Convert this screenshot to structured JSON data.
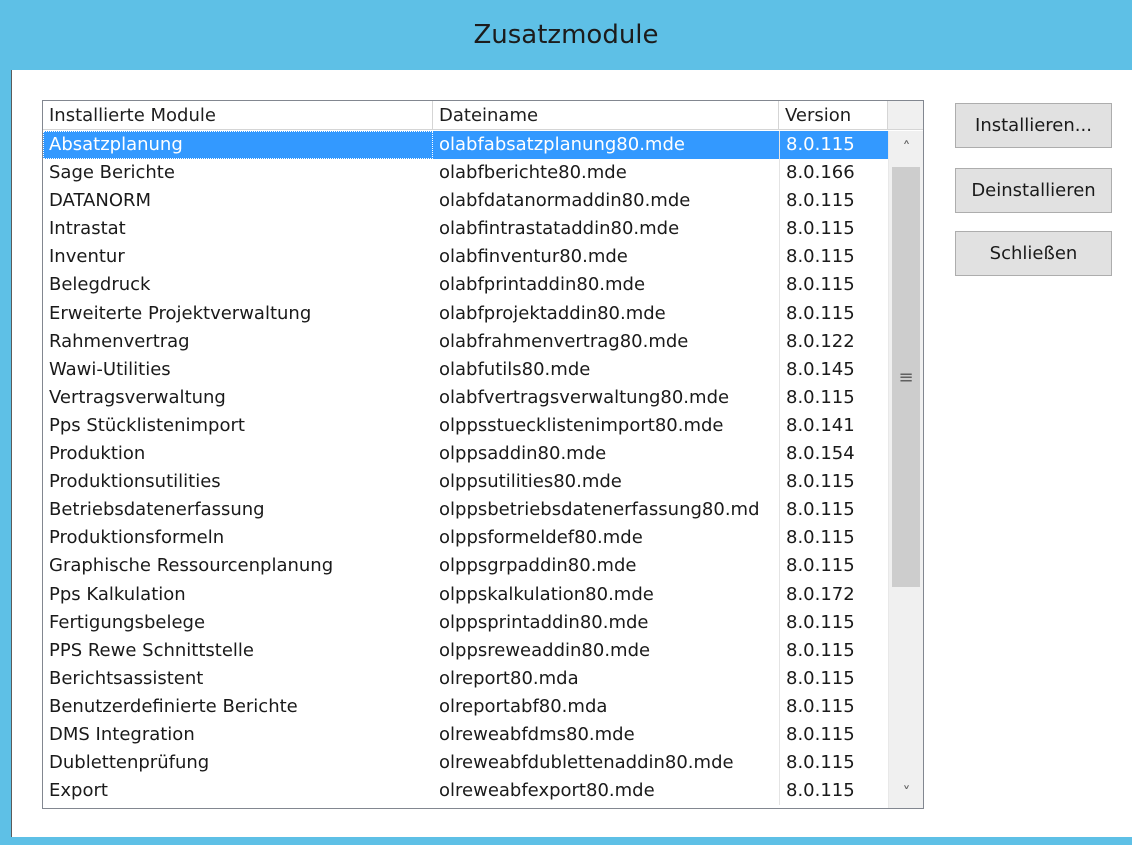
{
  "window": {
    "title": "Zusatzmodule"
  },
  "table": {
    "columns": [
      "Installierte Module",
      "Dateiname",
      "Version"
    ],
    "rows": [
      {
        "name": "Absatzplanung",
        "file": "olabfabsatzplanung80.mde",
        "version": "8.0.115"
      },
      {
        "name": "Sage Berichte",
        "file": "olabfberichte80.mde",
        "version": "8.0.166"
      },
      {
        "name": "DATANORM",
        "file": "olabfdatanormaddin80.mde",
        "version": "8.0.115"
      },
      {
        "name": "Intrastat",
        "file": "olabfintrastataddin80.mde",
        "version": "8.0.115"
      },
      {
        "name": "Inventur",
        "file": "olabfinventur80.mde",
        "version": "8.0.115"
      },
      {
        "name": "Belegdruck",
        "file": "olabfprintaddin80.mde",
        "version": "8.0.115"
      },
      {
        "name": "Erweiterte Projektverwaltung",
        "file": "olabfprojektaddin80.mde",
        "version": "8.0.115"
      },
      {
        "name": "Rahmenvertrag",
        "file": "olabfrahmenvertrag80.mde",
        "version": "8.0.122"
      },
      {
        "name": "Wawi-Utilities",
        "file": "olabfutils80.mde",
        "version": "8.0.145"
      },
      {
        "name": "Vertragsverwaltung",
        "file": "olabfvertragsverwaltung80.mde",
        "version": "8.0.115"
      },
      {
        "name": "Pps Stücklistenimport",
        "file": "olppsstuecklistenimport80.mde",
        "version": "8.0.141"
      },
      {
        "name": "Produktion",
        "file": "olppsaddin80.mde",
        "version": "8.0.154"
      },
      {
        "name": "Produktionsutilities",
        "file": "olppsutilities80.mde",
        "version": "8.0.115"
      },
      {
        "name": "Betriebsdatenerfassung",
        "file": "olppsbetriebsdatenerfassung80.md",
        "version": "8.0.115"
      },
      {
        "name": "Produktionsformeln",
        "file": "olppsformeldef80.mde",
        "version": "8.0.115"
      },
      {
        "name": "Graphische Ressourcenplanung",
        "file": "olppsgrpaddin80.mde",
        "version": "8.0.115"
      },
      {
        "name": "Pps Kalkulation",
        "file": "olppskalkulation80.mde",
        "version": "8.0.172"
      },
      {
        "name": "Fertigungsbelege",
        "file": "olppsprintaddin80.mde",
        "version": "8.0.115"
      },
      {
        "name": "PPS Rewe Schnittstelle",
        "file": "olppsreweaddin80.mde",
        "version": "8.0.115"
      },
      {
        "name": "Berichtsassistent",
        "file": "olreport80.mda",
        "version": "8.0.115"
      },
      {
        "name": "Benutzerdefinierte Berichte",
        "file": "olreportabf80.mda",
        "version": "8.0.115"
      },
      {
        "name": "DMS Integration",
        "file": "olreweabfdms80.mde",
        "version": "8.0.115"
      },
      {
        "name": "Dublettenprüfung",
        "file": "olreweabfdublettenaddin80.mde",
        "version": "8.0.115"
      },
      {
        "name": "Export",
        "file": "olreweabfexport80.mde",
        "version": "8.0.115"
      }
    ],
    "selected_index": 0
  },
  "buttons": {
    "install": "Installieren...",
    "uninstall": "Deinstallieren",
    "close": "Schließen"
  },
  "scrollbar": {
    "up_glyph": "˄",
    "down_glyph": "˅",
    "grip_glyph": "≡"
  },
  "colors": {
    "title_bar": "#5ec0e6",
    "selection": "#3399ff"
  }
}
